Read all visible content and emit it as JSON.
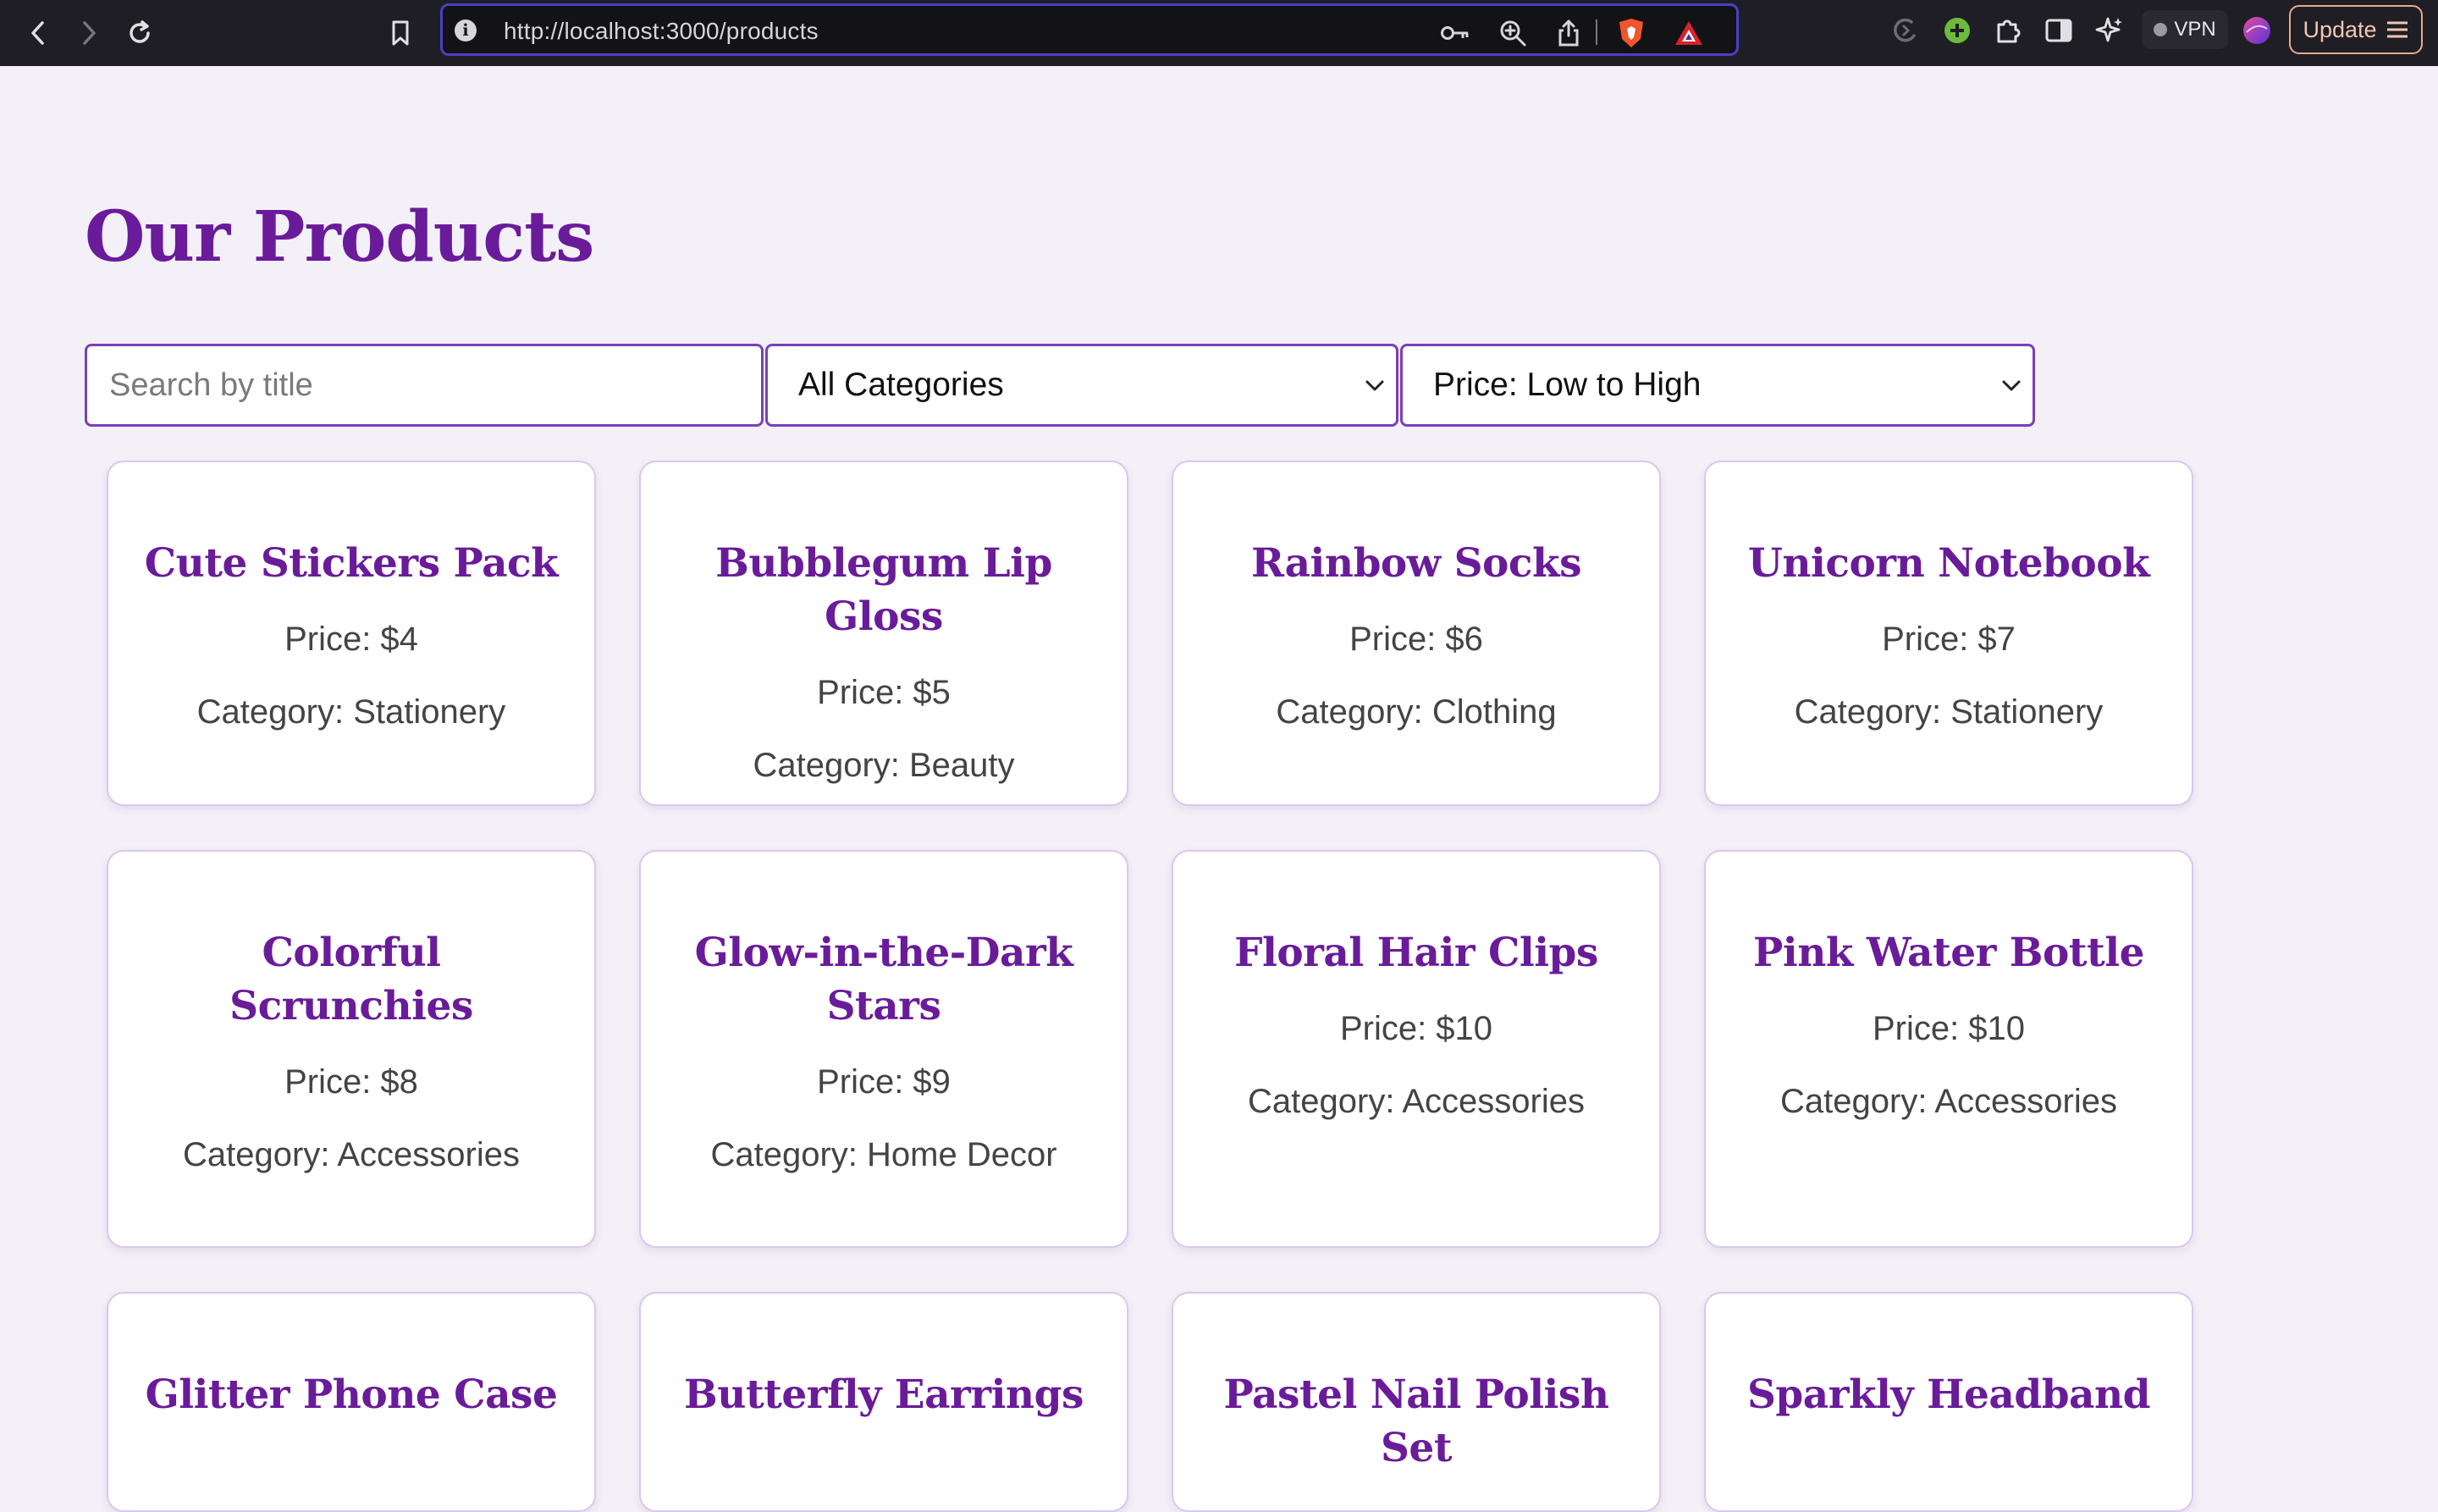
{
  "browser": {
    "url": "http://localhost:3000/products",
    "vpn_label": "VPN",
    "update_label": "Update"
  },
  "page": {
    "title": "Our Products"
  },
  "filters": {
    "search_placeholder": "Search by title",
    "search_value": "",
    "category_selected": "All Categories",
    "sort_selected": "Price: Low to High"
  },
  "products": [
    {
      "title": "Cute Stickers Pack",
      "price": "Price: $4",
      "category": "Category: Stationery"
    },
    {
      "title": "Bubblegum Lip Gloss",
      "price": "Price: $5",
      "category": "Category: Beauty"
    },
    {
      "title": "Rainbow Socks",
      "price": "Price: $6",
      "category": "Category: Clothing"
    },
    {
      "title": "Unicorn Notebook",
      "price": "Price: $7",
      "category": "Category: Stationery"
    },
    {
      "title": "Colorful Scrunchies",
      "price": "Price: $8",
      "category": "Category: Accessories"
    },
    {
      "title": "Glow-in-the-Dark Stars",
      "price": "Price: $9",
      "category": "Category: Home Decor"
    },
    {
      "title": "Floral Hair Clips",
      "price": "Price: $10",
      "category": "Category: Accessories"
    },
    {
      "title": "Pink Water Bottle",
      "price": "Price: $10",
      "category": "Category: Accessories"
    },
    {
      "title": "Glitter Phone Case",
      "price": "",
      "category": ""
    },
    {
      "title": "Butterfly Earrings",
      "price": "",
      "category": ""
    },
    {
      "title": "Pastel Nail Polish Set",
      "price": "",
      "category": ""
    },
    {
      "title": "Sparkly Headband",
      "price": "",
      "category": ""
    }
  ],
  "colors": {
    "accent": "#6a1b9a",
    "border": "#7b3fb8",
    "background": "#f3f0f7"
  }
}
